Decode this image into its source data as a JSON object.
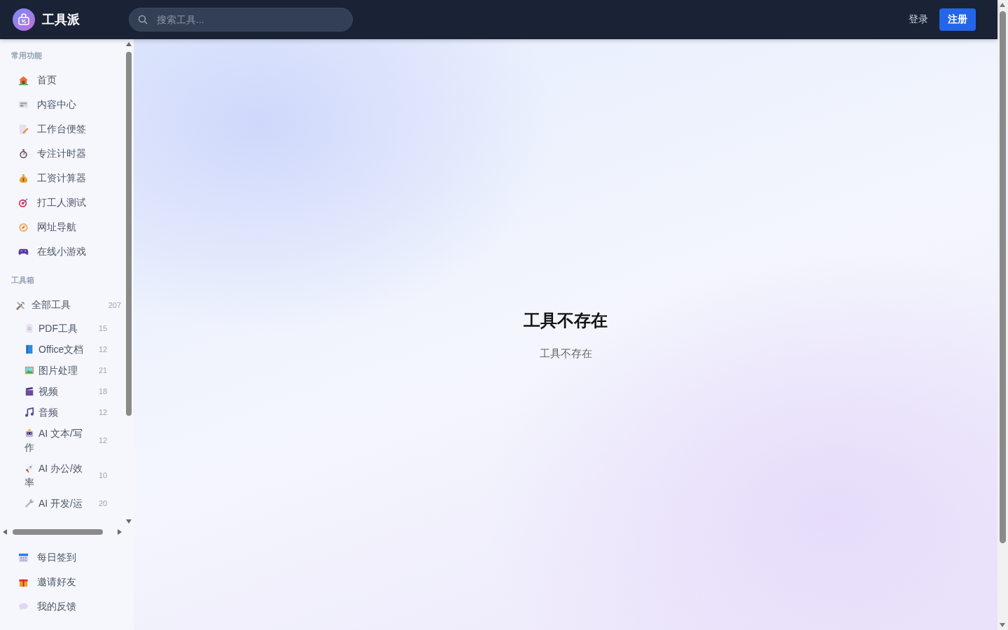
{
  "header": {
    "logo_text": "工具派",
    "search": {
      "placeholder": "搜索工具..."
    },
    "login": "登录",
    "register": "注册"
  },
  "sidebar": {
    "sections": [
      {
        "title": "常用功能",
        "items": [
          {
            "label": "首页"
          },
          {
            "label": "内容中心"
          },
          {
            "label": "工作台便签"
          },
          {
            "label": "专注计时器"
          },
          {
            "label": "工资计算器"
          },
          {
            "label": "打工人测试"
          },
          {
            "label": "网址导航"
          },
          {
            "label": "在线小游戏"
          }
        ]
      },
      {
        "title": "工具箱",
        "all": {
          "label": "全部工具",
          "count": "207"
        },
        "items": [
          {
            "label": "PDF工具",
            "count": "15"
          },
          {
            "label": "Office文档",
            "count": "12"
          },
          {
            "label": "图片处理",
            "count": "21"
          },
          {
            "label": "视频",
            "count": "18"
          },
          {
            "label": "音频",
            "count": "12"
          },
          {
            "label": "AI 文本/写作",
            "count": "12"
          },
          {
            "label": "AI 办公/效率",
            "count": "10"
          },
          {
            "label": "AI 开发/运",
            "count": "20"
          }
        ]
      }
    ],
    "bottom_items": [
      {
        "label": "每日签到"
      },
      {
        "label": "邀请好友"
      },
      {
        "label": "我的反馈"
      }
    ]
  },
  "main": {
    "title": "工具不存在",
    "message": "工具不存在"
  }
}
